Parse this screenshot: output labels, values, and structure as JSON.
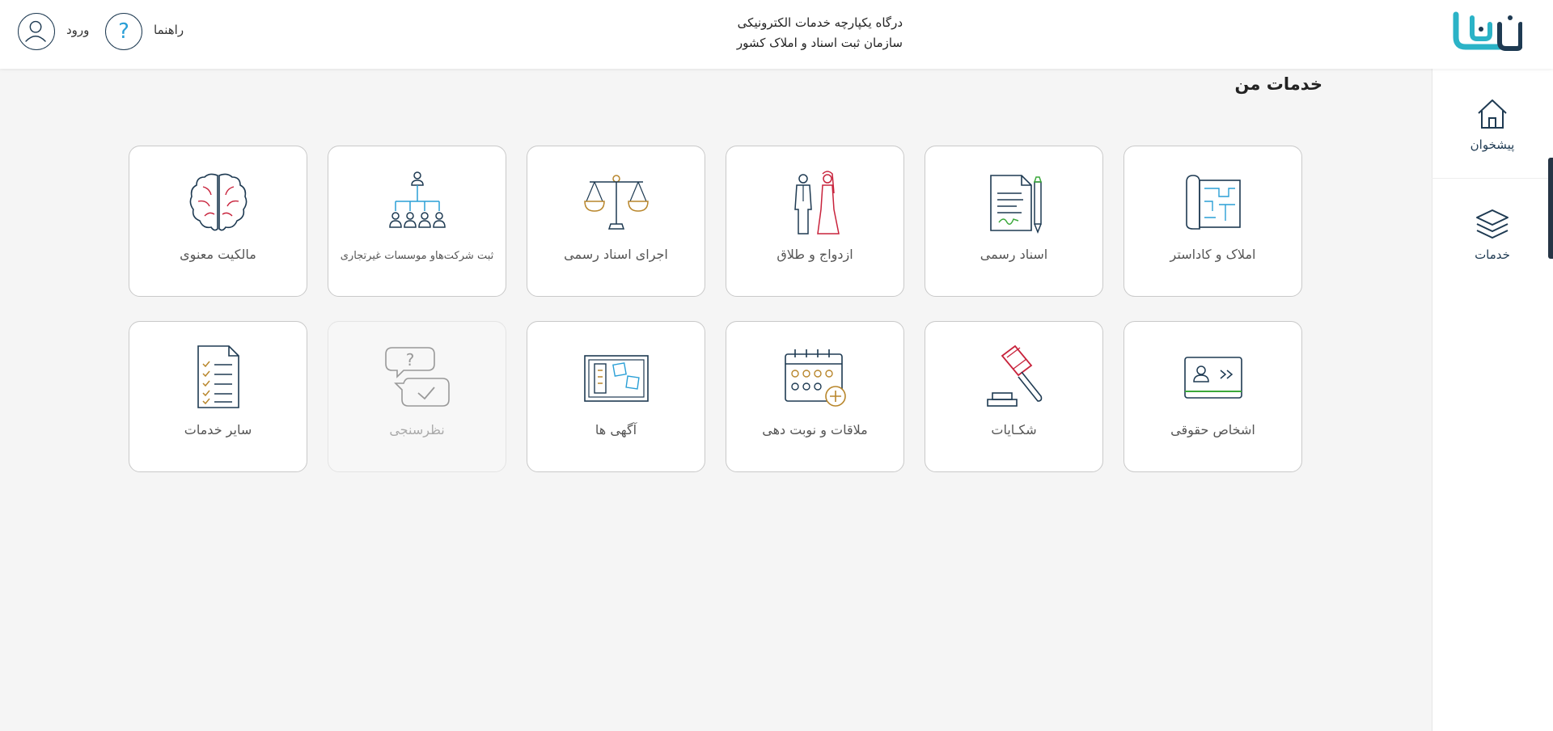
{
  "header": {
    "title_line1": "درگاه یکپارچه خدمات الکترونیکی",
    "title_line2": "سازمان ثبت اسناد و املاک کشور",
    "logo_icon": "sabt-man-logo",
    "help_label": "راهنما",
    "help_icon": "question-circle-icon",
    "login_label": "ورود",
    "avatar_icon": "user-circle-icon"
  },
  "sidebar": {
    "items": [
      {
        "label": "پیشخوان",
        "icon": "home-icon"
      },
      {
        "label": "خدمات",
        "icon": "layers-icon"
      }
    ]
  },
  "main": {
    "title": "خدمات من",
    "tiles": [
      {
        "label": "املاک و کاداستر",
        "icon": "map-scroll-icon"
      },
      {
        "label": "اسناد رسمی",
        "icon": "document-pen-icon"
      },
      {
        "label": "ازدواج و طلاق",
        "icon": "bride-groom-icon"
      },
      {
        "label": "اجرای اسناد رسمی",
        "icon": "scales-icon"
      },
      {
        "label": "ثبت شرکت‌هاو موسسات غیرتجاری",
        "icon": "org-chart-icon"
      },
      {
        "label": "مالکیت معنوی",
        "icon": "brain-icon"
      },
      {
        "label": "اشخاص حقوقی",
        "icon": "id-card-icon"
      },
      {
        "label": "شکـایات",
        "icon": "gavel-icon"
      },
      {
        "label": "ملاقات و نوبت دهی",
        "icon": "calendar-plus-icon"
      },
      {
        "label": "آگهی ها",
        "icon": "bulletin-board-icon"
      },
      {
        "label": "نظرسنجی",
        "icon": "survey-chat-icon",
        "disabled": true
      },
      {
        "label": "سایر خدمات",
        "icon": "checklist-icon"
      }
    ]
  },
  "colors": {
    "navy": "#1e3a52",
    "teal": "#2a9fd6",
    "gold": "#b8862b",
    "red": "#c8233c",
    "green": "#3aa83a"
  }
}
